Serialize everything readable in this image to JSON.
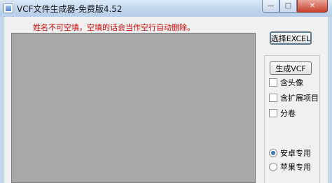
{
  "window": {
    "title": "VCF文件生成器-免费版4.52",
    "min_symbol": "—",
    "max_symbol": "□",
    "close_symbol": "✕"
  },
  "warning_text": "姓名不可空填，空填的话会当作空行自动删除。",
  "buttons": {
    "select_excel": "选择EXCEL",
    "generate_vcf": "生成VCF"
  },
  "options": {
    "include_avatar": "含头像",
    "include_extended": "含扩展项目",
    "split_volume": "分卷"
  },
  "device": {
    "android": "安卓专用",
    "apple": "苹果专用",
    "selected": "android"
  }
}
